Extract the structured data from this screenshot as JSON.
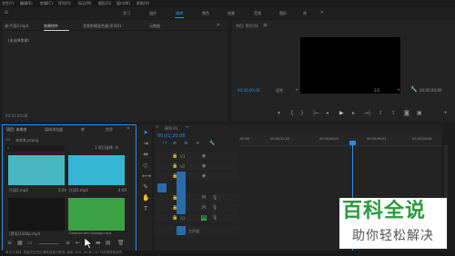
{
  "menu": [
    "文件(F)",
    "编辑(E)",
    "剪辑(C)",
    "序列(S)",
    "标记(M)",
    "图形(G)",
    "窗口(W)",
    "帮助(H)"
  ],
  "workspaces": [
    "学习",
    "组件",
    "编辑",
    "颜色",
    "效果",
    "音频",
    "图形",
    "库"
  ],
  "workspace_active": 2,
  "source_panel": {
    "tabs": [
      "源:片段2.mp4",
      "效果控件",
      "音频剪辑混合器:序列01",
      "元数据"
    ],
    "active_tab": 1,
    "no_clip": "(未选择剪辑)",
    "timecode": "00:01:20:08"
  },
  "program": {
    "title": "节目: 序列 01",
    "timecode_left": "00;00;00;00",
    "fit": "适合",
    "resolution": "1/2",
    "timecode_right": "00;00;00;00"
  },
  "project": {
    "tabs": [
      "项目: 未命名",
      "媒体浏览器",
      "库",
      "信息"
    ],
    "name": "未命名.prproj",
    "count": "1 项已选择, 共",
    "clips": [
      {
        "name": "片段2.mp4",
        "duration": "4:00",
        "color": "#47b8c3"
      },
      {
        "name": "片段3.mp4",
        "duration": "4:00",
        "color": "#35b6d3"
      },
      {
        "name": "(黑场)1440p.mp4",
        "duration": "",
        "color": "#1a1a1a"
      },
      {
        "name": "Greenscreen Footage.mp4",
        "duration": "",
        "color": "#3da246"
      }
    ]
  },
  "timeline": {
    "tab": "序列 01",
    "timecode": "00;01;20;08",
    "ruler": [
      ":00;00",
      "00;00;32;00",
      "00;00;64;02",
      "00;00;96;02",
      "00;02;08;04"
    ],
    "video_tracks": [
      "V3",
      "V2",
      "V1"
    ],
    "audio_tracks": [
      "A1",
      "A2",
      "A3"
    ],
    "master": "主声道"
  },
  "tools": [
    "selection-tool",
    "track-select-tool",
    "ripple-edit-tool",
    "razor-tool",
    "slip-tool",
    "pen-tool",
    "hand-tool",
    "type-tool"
  ],
  "status_text": "单击可选择, 或者在空白区域拖动进行框选, 使用 Shift, Alt 和 Ctrl 可获得其他选项。",
  "watermark": {
    "title": "百科全说",
    "subtitle": "助你轻松解决"
  },
  "colors": {
    "accent": "#2d8ceb",
    "panel": "#232323",
    "bg": "#1d1d1d",
    "selected_track": "#2b6ca8"
  }
}
